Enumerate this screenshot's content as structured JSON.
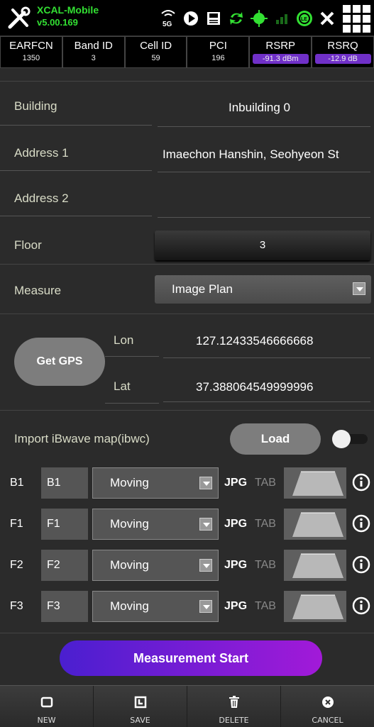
{
  "app": {
    "name": "XCAL-Mobile",
    "version": "v5.00.169"
  },
  "status_icons": [
    "5g-icon",
    "play-icon",
    "save-disk-icon",
    "sync-icon",
    "gps-target-icon",
    "signal-bars-icon",
    "recording-icon",
    "cross-icon"
  ],
  "metrics": [
    {
      "label": "EARFCN",
      "value": "1350"
    },
    {
      "label": "Band ID",
      "value": "3"
    },
    {
      "label": "Cell ID",
      "value": "59"
    },
    {
      "label": "PCI",
      "value": "196"
    },
    {
      "label": "RSRP",
      "value": "-91.3 dBm"
    },
    {
      "label": "RSRQ",
      "value": "-12.9 dB"
    }
  ],
  "form": {
    "building_label": "Building",
    "building_value": "Inbuilding 0",
    "address1_label": "Address 1",
    "address1_value": "Imaechon Hanshin, Seohyeon St",
    "address2_label": "Address 2",
    "address2_value": "",
    "floor_label": "Floor",
    "floor_value": "3",
    "measure_label": "Measure",
    "measure_value": "Image Plan",
    "gps_button": "Get GPS",
    "lon_label": "Lon",
    "lon_value": "127.12433546666668",
    "lat_label": "Lat",
    "lat_value": "37.388064549999996",
    "import_label": "Import iBwave map(ibwc)",
    "load_button": "Load"
  },
  "floors": [
    {
      "label": "B1",
      "name": "B1",
      "mode": "Moving",
      "jpg": "JPG",
      "tab": "TAB"
    },
    {
      "label": "F1",
      "name": "F1",
      "mode": "Moving",
      "jpg": "JPG",
      "tab": "TAB"
    },
    {
      "label": "F2",
      "name": "F2",
      "mode": "Moving",
      "jpg": "JPG",
      "tab": "TAB"
    },
    {
      "label": "F3",
      "name": "F3",
      "mode": "Moving",
      "jpg": "JPG",
      "tab": "TAB"
    }
  ],
  "start_button": "Measurement Start",
  "bottom_bar": [
    {
      "label": "NEW",
      "icon": "new-icon"
    },
    {
      "label": "SAVE",
      "icon": "save-icon"
    },
    {
      "label": "DELETE",
      "icon": "trash-icon"
    },
    {
      "label": "CANCEL",
      "icon": "cancel-icon"
    }
  ],
  "colors": {
    "accent_green": "#33e033",
    "highlight_purple": "#7030c8",
    "start_gradient_from": "#4a1fd0",
    "start_gradient_to": "#a21ad8"
  }
}
